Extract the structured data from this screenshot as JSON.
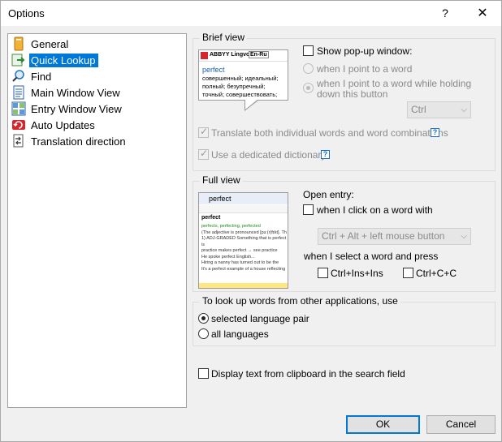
{
  "window": {
    "title": "Options",
    "help_glyph": "?",
    "close_glyph": "✕"
  },
  "nav": {
    "items": [
      {
        "label": "General",
        "icon": "general-icon"
      },
      {
        "label": "Quick Lookup",
        "icon": "quick-lookup-icon",
        "selected": true
      },
      {
        "label": "Find",
        "icon": "magnifier-icon"
      },
      {
        "label": "Main Window View",
        "icon": "document-icon"
      },
      {
        "label": "Entry Window View",
        "icon": "grid-icon"
      },
      {
        "label": "Auto Updates",
        "icon": "update-icon"
      },
      {
        "label": "Translation direction",
        "icon": "direction-icon"
      }
    ]
  },
  "brief_view": {
    "title": "Brief view",
    "preview": {
      "brand": "ABBYY Lingvo",
      "lang": "En-Ru",
      "word": "perfect",
      "translations": "совершенный; идеальный; полный; безупречный; точный; совершествовать;"
    },
    "show_popup_label": "Show pop-up window:",
    "radio_point_label": "when I point to a word",
    "radio_hold_label": "when I point to a word while holding down this button",
    "modifier_value": "Ctrl",
    "translate_both_label": "Translate both individual words and word combinations",
    "dedicated_dict_label": "Use a dedicated dictionary",
    "help_glyph": "?"
  },
  "full_view": {
    "title": "Full view",
    "preview": {
      "tab_word": "perfect",
      "word": "perfect",
      "forms": "perfects, perfecting, perfected",
      "line1": "(The adjective is pronounced [pɜː(r)fɪkt]. Th",
      "line2": "1) ADJ-GRADED Something that is perfect is",
      "line3": "practice makes perfect → see practice",
      "line4": "He spoke perfect English...",
      "line5": "Hiring a nanny has turned out to be the",
      "line6": "It's a perfect example of a house reflecting"
    },
    "open_entry_label": "Open entry:",
    "click_word_label": "when I click on a word with",
    "click_combo_value": "Ctrl + Alt + left mouse button",
    "select_word_label": "when I select a word and press",
    "ctrl_ins_label": "Ctrl+Ins+Ins",
    "ctrl_c_label": "Ctrl+C+C"
  },
  "lookup_other": {
    "title": "To look up words from other applications, use",
    "selected_pair_label": "selected language pair",
    "all_languages_label": "all languages"
  },
  "clipboard_label": "Display text from clipboard in the search field",
  "buttons": {
    "ok": "OK",
    "cancel": "Cancel"
  }
}
